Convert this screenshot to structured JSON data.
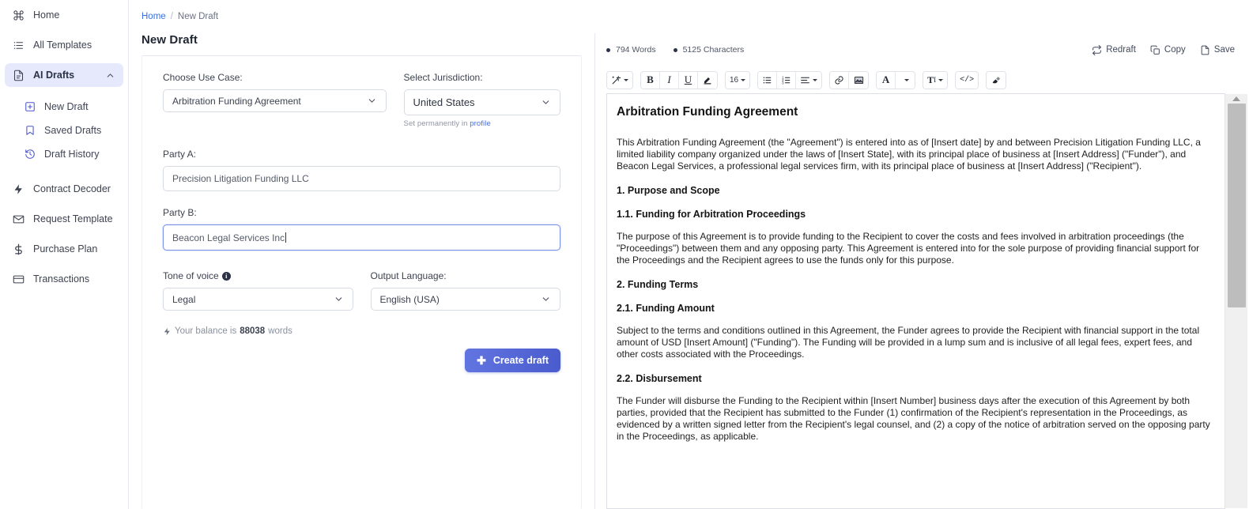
{
  "sidebar": {
    "items": [
      {
        "label": "Home",
        "icon": "home-command-icon",
        "active": false,
        "sub": false
      },
      {
        "label": "All Templates",
        "icon": "list-icon",
        "active": false,
        "sub": false
      },
      {
        "label": "AI Drafts",
        "icon": "document-icon",
        "active": true,
        "sub": false,
        "chevron": "chevron-up-icon"
      },
      {
        "label": "New Draft",
        "icon": "plus-square-icon",
        "active": false,
        "sub": true
      },
      {
        "label": "Saved Drafts",
        "icon": "bookmark-icon",
        "active": false,
        "sub": true
      },
      {
        "label": "Draft History",
        "icon": "history-clock-icon",
        "active": false,
        "sub": true
      },
      {
        "label": "Contract Decoder",
        "icon": "bolt-icon",
        "active": false,
        "sub": false
      },
      {
        "label": "Request Template",
        "icon": "envelope-icon",
        "active": false,
        "sub": false
      },
      {
        "label": "Purchase Plan",
        "icon": "dollar-icon",
        "active": false,
        "sub": false
      },
      {
        "label": "Transactions",
        "icon": "credit-card-icon",
        "active": false,
        "sub": false
      }
    ],
    "active_bg": "#e6e9fc"
  },
  "breadcrumb": {
    "home": "Home",
    "separator": "/",
    "current": "New Draft"
  },
  "page": {
    "title": "New Draft"
  },
  "form": {
    "use_case": {
      "label": "Choose Use Case:",
      "value": "Arbitration Funding Agreement"
    },
    "jurisdiction": {
      "label": "Select Jurisdiction:",
      "value": "United States",
      "hint_prefix": "Set permanently in ",
      "hint_link": "profile"
    },
    "party_a": {
      "label": "Party A:",
      "value": "Precision Litigation Funding LLC",
      "placeholder": "Party A"
    },
    "party_b": {
      "label": "Party B:",
      "value": "Beacon Legal Services Inc",
      "placeholder": "Party B"
    },
    "tone": {
      "label": "Tone of voice",
      "value": "Legal"
    },
    "language": {
      "label": "Output Language:",
      "value": "English (USA)"
    },
    "balance": {
      "prefix": "Your balance is ",
      "amount": "88038",
      "suffix": " words"
    },
    "create_button": "Create draft"
  },
  "editor": {
    "words": "794 Words",
    "characters": "5125 Characters",
    "actions": [
      {
        "label": "Redraft",
        "icon": "redraft-icon"
      },
      {
        "label": "Copy",
        "icon": "copy-icon"
      },
      {
        "label": "Save",
        "icon": "save-file-icon"
      }
    ],
    "toolbar": {
      "font_size": "16",
      "buttons": [
        "magic-wand-icon",
        "bold-icon",
        "italic-icon",
        "underline-icon",
        "highlighter-icon",
        "font-size-selector",
        "bullet-list-icon",
        "numbered-list-icon",
        "align-icon",
        "link-icon",
        "image-icon",
        "font-color-icon",
        "font-color-swatch",
        "text-style-icon",
        "code-icon",
        "clear-format-icon"
      ]
    }
  },
  "document": {
    "title": "Arbitration Funding Agreement",
    "blocks": [
      {
        "type": "p",
        "text": "This Arbitration Funding Agreement (the \"Agreement\") is entered into as of [Insert date] by and between Precision Litigation Funding LLC, a limited liability company organized under the laws of [Insert State], with its principal place of business at [Insert Address] (\"Funder\"), and Beacon Legal Services, a professional legal services firm, with its principal place of business at [Insert Address] (\"Recipient\")."
      },
      {
        "type": "h3",
        "text": "1. Purpose and Scope"
      },
      {
        "type": "h3",
        "text": "1.1. Funding for Arbitration Proceedings"
      },
      {
        "type": "p",
        "text": "The purpose of this Agreement is to provide funding to the Recipient to cover the costs and fees involved in arbitration proceedings (the \"Proceedings\") between them and any opposing party. This Agreement is entered into for the sole purpose of providing financial support for the Proceedings and the Recipient agrees to use the funds only for this purpose."
      },
      {
        "type": "h3",
        "text": "2. Funding Terms"
      },
      {
        "type": "h3",
        "text": "2.1. Funding Amount"
      },
      {
        "type": "p",
        "text": "Subject to the terms and conditions outlined in this Agreement, the Funder agrees to provide the Recipient with financial support in the total amount of USD [Insert Amount] (\"Funding\"). The Funding will be provided in a lump sum and is inclusive of all legal fees, expert fees, and other costs associated with the Proceedings."
      },
      {
        "type": "h3",
        "text": "2.2. Disbursement"
      },
      {
        "type": "p",
        "text": "The Funder will disburse the Funding to the Recipient within [Insert Number] business days after the execution of this Agreement by both parties, provided that the Recipient has submitted to the Funder (1) confirmation of the Recipient's representation in the Proceedings, as evidenced by a written signed letter from the Recipient's legal counsel, and (2) a copy of the notice of arbitration served on the opposing party in the Proceedings, as applicable."
      }
    ]
  }
}
